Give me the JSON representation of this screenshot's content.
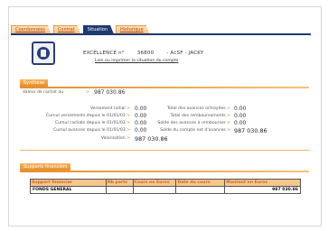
{
  "tabs": [
    {
      "label": "Coordonnées",
      "active": false
    },
    {
      "label": "Contrat",
      "active": false
    },
    {
      "label": "Situation",
      "active": true
    },
    {
      "label": "Historique",
      "active": false
    }
  ],
  "account": {
    "product": "EXCELLENCE n°",
    "number": "36800",
    "holder": "- AcSF - JACKY",
    "link": "Lien ou imprimer la situation du compte"
  },
  "synthese": {
    "title": "Synthèse",
    "valeur_rachat_label": "Valeur de rachat au",
    "valeur_rachat_value": "987 030.86",
    "left": [
      {
        "label": "Versement initial",
        "value": "0.00"
      },
      {
        "label": "Cumul versements depuis le 01/01/03",
        "value": "0.00"
      },
      {
        "label": "Cumul rachats depuis le 01/01/03",
        "value": "0.00"
      },
      {
        "label": "Cumul avances depuis le 01/01/03",
        "value": "0.00"
      },
      {
        "label": "Valorisation",
        "value": "987 030.86"
      }
    ],
    "right": [
      {
        "label": "Total des avances octroyées",
        "value": "0.00"
      },
      {
        "label": "Total des remboursements",
        "value": "0.00"
      },
      {
        "label": "Solde des avances à rembourser",
        "value": "0.00"
      },
      {
        "label": "Solde du compte net d'avances",
        "value": "987 030.86"
      }
    ]
  },
  "supports": {
    "title": "Supports financiers",
    "headers": [
      "Support financier",
      "Nb parts",
      "Cours en Euros",
      "Date du cours",
      "Montant en Euros"
    ],
    "rows": [
      [
        "FONDS GENERAL",
        "",
        "",
        "",
        "987 030.86"
      ]
    ]
  },
  "colors": {
    "accent": "#e58e2c",
    "navy": "#1e3a6e"
  }
}
